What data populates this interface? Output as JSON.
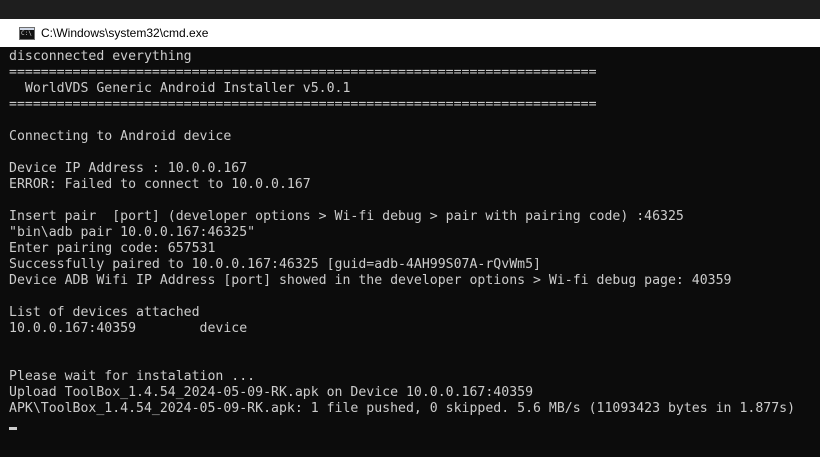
{
  "window": {
    "title": "C:\\Windows\\system32\\cmd.exe",
    "icon": "cmd-app-icon"
  },
  "console": {
    "lines": [
      "disconnected everything",
      "==========================================================================",
      "  WorldVDS Generic Android Installer v5.0.1",
      "==========================================================================",
      "",
      "Connecting to Android device",
      "",
      "Device IP Address : 10.0.0.167",
      "ERROR: Failed to connect to 10.0.0.167",
      "",
      "Insert pair  [port] (developer options > Wi-fi debug > pair with pairing code) :46325",
      "\"bin\\adb pair 10.0.0.167:46325\"",
      "Enter pairing code: 657531",
      "Successfully paired to 10.0.0.167:46325 [guid=adb-4AH99S07A-rQvWm5]",
      "Device ADB Wifi IP Address [port] showed in the developer options > Wi-fi debug page: 40359",
      "",
      "List of devices attached",
      "10.0.0.167:40359        device",
      "",
      "",
      "Please wait for instalation ...",
      "Upload ToolBox_1.4.54_2024-05-09-RK.apk on Device 10.0.0.167:40359",
      "APK\\ToolBox_1.4.54_2024-05-09-RK.apk: 1 file pushed, 0 skipped. 5.6 MB/s (11093423 bytes in 1.877s)"
    ]
  },
  "colors": {
    "background": "#0c0c0c",
    "text": "#cccccc",
    "titlebar": "#ffffff"
  }
}
